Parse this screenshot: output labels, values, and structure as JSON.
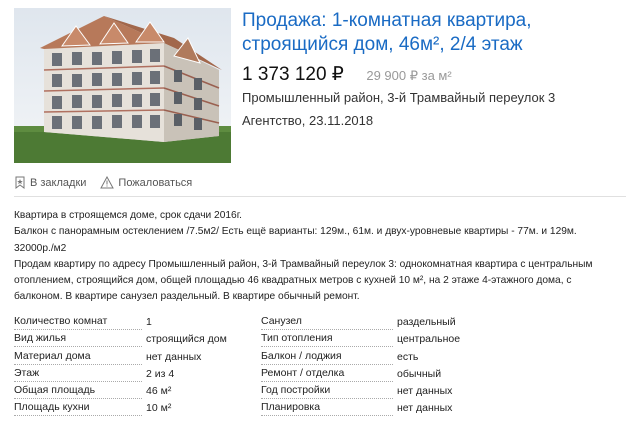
{
  "listing": {
    "title": "Продажа: 1-комнатная квартира, строящийся дом, 46м², 2/4 этаж",
    "price": "1 373 120 ₽",
    "price_per_m2": "29 900 ₽ за м²",
    "address": "Промышленный район, 3-й Трамвайный переулок 3",
    "agency": "Агентство, 23.11.2018"
  },
  "actions": {
    "bookmark": "В закладки",
    "complain": "Пожаловаться"
  },
  "description": [
    "Квартира в строящемся доме, срок сдачи 2016г.",
    "Балкон с панорамным остеклением /7.5м2/ Есть ещё варианты: 129м., 61м. и двух-уровневые квартиры - 77м. и 129м. 32000р./м2",
    "Продам квартиру по адресу Промышленный район, 3-й Трамвайный переулок 3: однокомнатная квартира с центральным отоплением, строящийся дом, общей площадью 46 квадратных метров с кухней 10 м², на 2 этаже 4-этажного дома, с балконом. В квартире санузел раздельный. В квартире обычный ремонт."
  ],
  "params_left": [
    {
      "key": "Количество комнат",
      "value": "1"
    },
    {
      "key": "Вид жилья",
      "value": "строящийся дом"
    },
    {
      "key": "Материал дома",
      "value": "нет данных"
    },
    {
      "key": "Этаж",
      "value": "2 из 4"
    },
    {
      "key": "Общая площадь",
      "value": "46 м²"
    },
    {
      "key": "Площадь кухни",
      "value": "10 м²"
    }
  ],
  "params_right": [
    {
      "key": "Санузел",
      "value": "раздельный"
    },
    {
      "key": "Тип отопления",
      "value": "центральное"
    },
    {
      "key": "Балкон / лоджия",
      "value": "есть"
    },
    {
      "key": "Ремонт / отделка",
      "value": "обычный"
    },
    {
      "key": "Год постройки",
      "value": "нет данных"
    },
    {
      "key": "Планировка",
      "value": "нет данных"
    }
  ],
  "icons": {
    "bookmark": "bookmark-star-icon",
    "complain": "warning-triangle-icon"
  },
  "colors": {
    "title_link": "#1a6bc4",
    "price_secondary": "#999999"
  }
}
